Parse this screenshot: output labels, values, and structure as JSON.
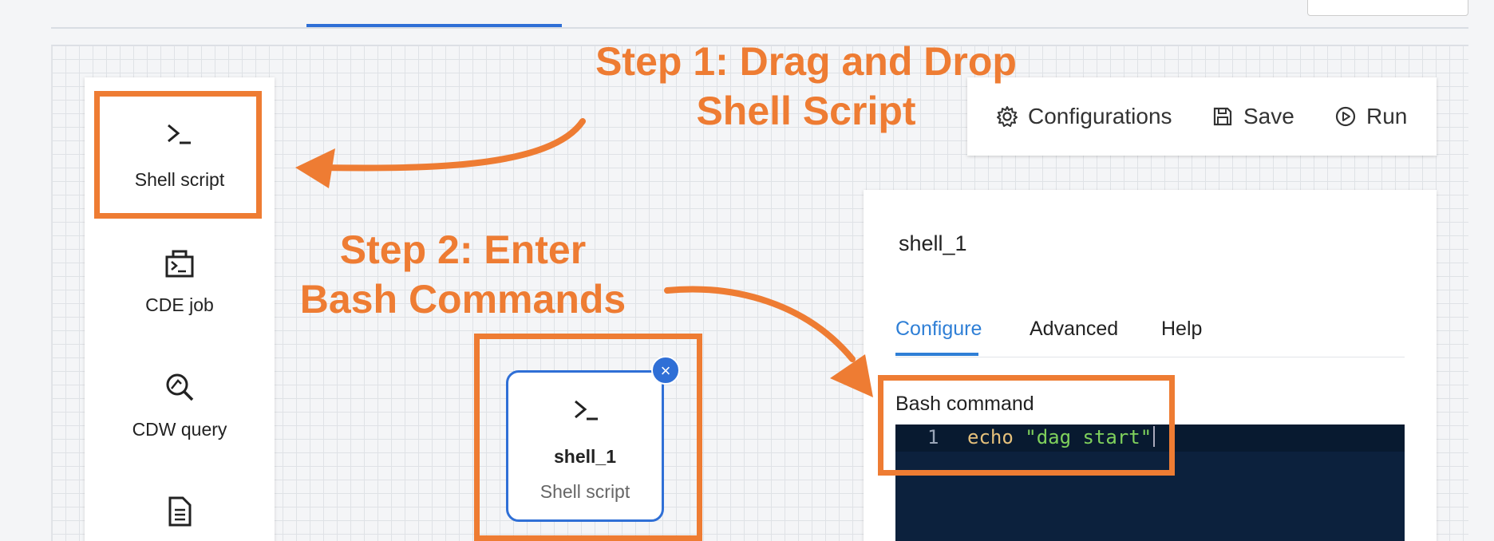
{
  "palette": {
    "items": [
      {
        "label": "Shell script",
        "icon": "terminal-icon"
      },
      {
        "label": "CDE job",
        "icon": "cde-job-icon"
      },
      {
        "label": "CDW query",
        "icon": "query-search-icon"
      },
      {
        "label": "",
        "icon": "document-icon"
      }
    ]
  },
  "toolbar": {
    "configurations_label": "Configurations",
    "save_label": "Save",
    "run_label": "Run"
  },
  "panel": {
    "title": "shell_1",
    "tabs": [
      "Configure",
      "Advanced",
      "Help"
    ],
    "active_tab": "Configure",
    "field_label": "Bash command",
    "editor": {
      "line_number": "1",
      "keyword": "echo",
      "string": "\"dag start\""
    }
  },
  "node": {
    "name": "shell_1",
    "type": "Shell script",
    "close_glyph": "×"
  },
  "annotations": {
    "step1_line1": "Step 1: Drag and Drop",
    "step1_line2": "Shell Script",
    "step2_line1": "Step 2: Enter",
    "step2_line2": "Bash Commands"
  },
  "colors": {
    "accent": "#2f6fd6",
    "annotation": "#ee7c33",
    "editor_bg": "#0c213d"
  }
}
